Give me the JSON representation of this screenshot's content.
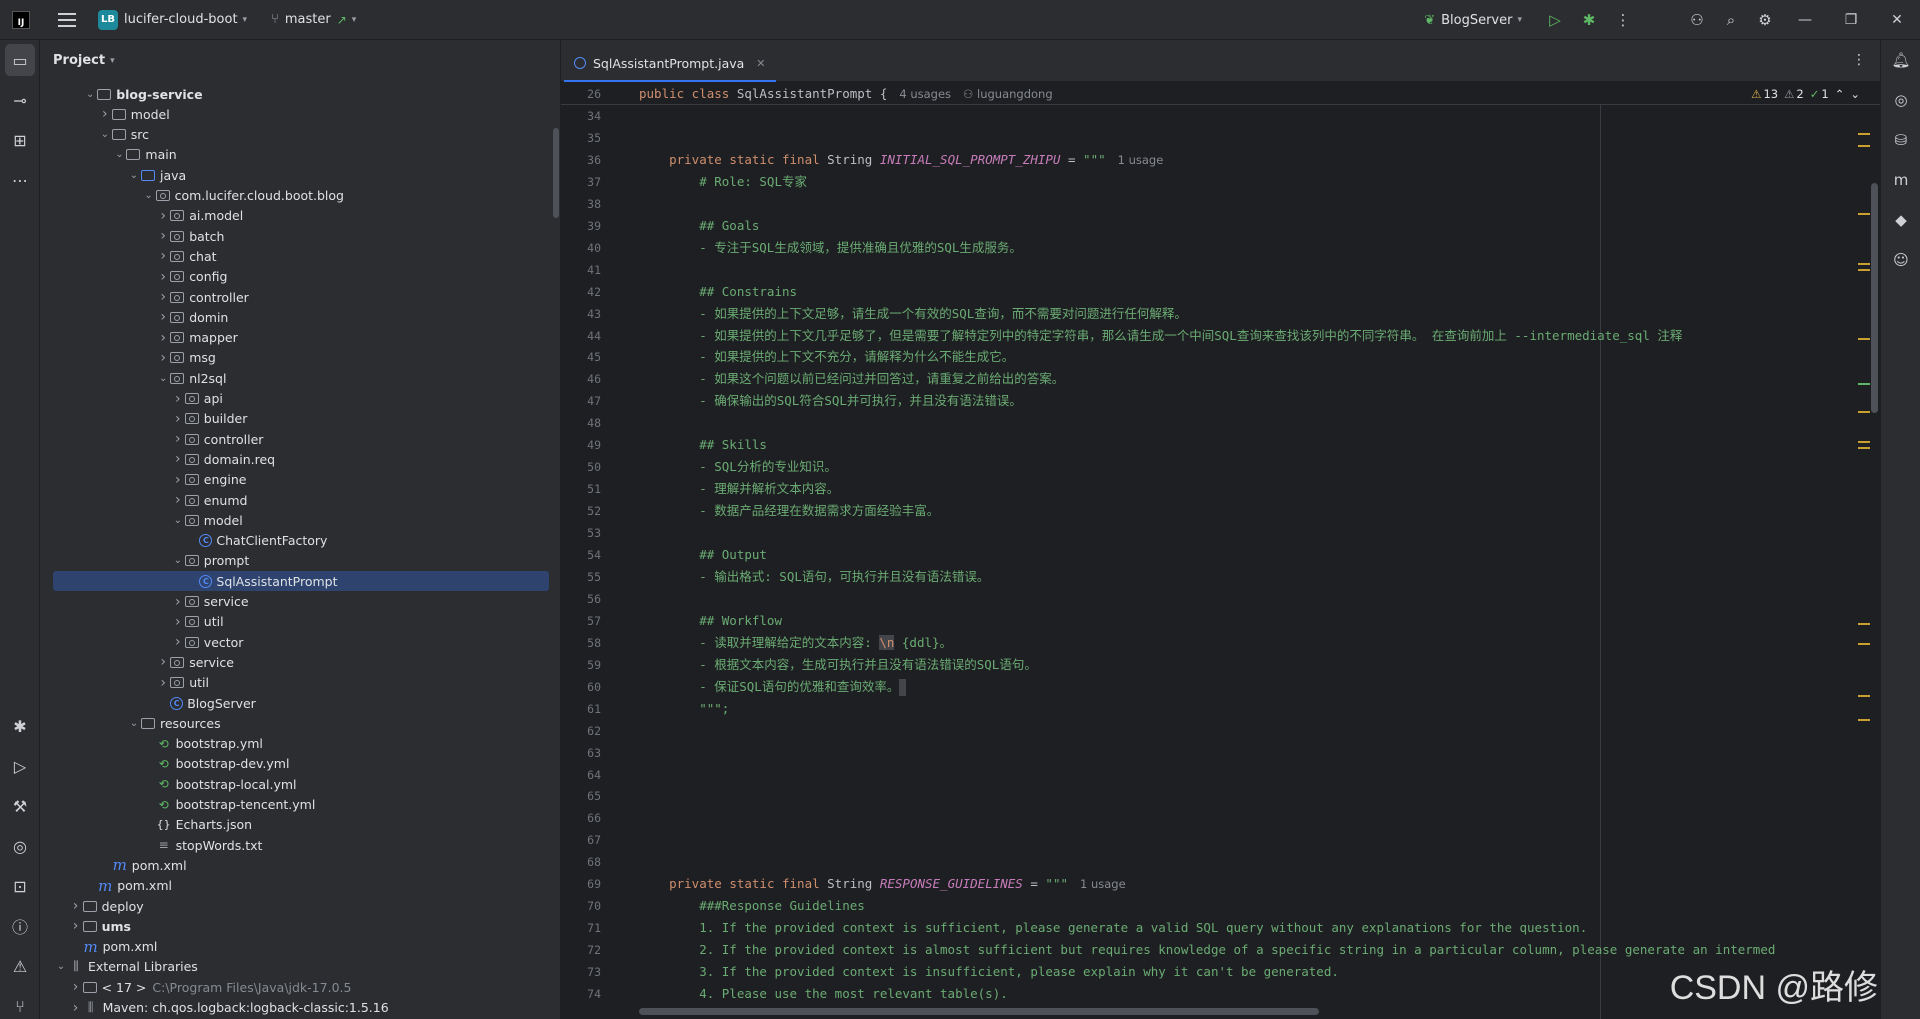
{
  "titlebar": {
    "app_logo": "IJ",
    "project_badge": "LB",
    "project_name": "lucifer-cloud-boot",
    "branch": "master",
    "run_config": "BlogServer"
  },
  "project_panel": {
    "title": "Project",
    "tree": [
      {
        "label": "blog-service",
        "depth": 2,
        "arrow": "open",
        "icon": "module",
        "bold": true
      },
      {
        "label": "model",
        "depth": 3,
        "arrow": "closed",
        "icon": "folder"
      },
      {
        "label": "src",
        "depth": 3,
        "arrow": "open",
        "icon": "folder"
      },
      {
        "label": "main",
        "depth": 4,
        "arrow": "open",
        "icon": "folder"
      },
      {
        "label": "java",
        "depth": 5,
        "arrow": "open",
        "icon": "srcfolder"
      },
      {
        "label": "com.lucifer.cloud.boot.blog",
        "depth": 6,
        "arrow": "open",
        "icon": "pkg"
      },
      {
        "label": "ai.model",
        "depth": 7,
        "arrow": "closed",
        "icon": "pkg"
      },
      {
        "label": "batch",
        "depth": 7,
        "arrow": "closed",
        "icon": "pkg"
      },
      {
        "label": "chat",
        "depth": 7,
        "arrow": "closed",
        "icon": "pkg"
      },
      {
        "label": "config",
        "depth": 7,
        "arrow": "closed",
        "icon": "pkg"
      },
      {
        "label": "controller",
        "depth": 7,
        "arrow": "closed",
        "icon": "pkg"
      },
      {
        "label": "domin",
        "depth": 7,
        "arrow": "closed",
        "icon": "pkg"
      },
      {
        "label": "mapper",
        "depth": 7,
        "arrow": "closed",
        "icon": "pkg"
      },
      {
        "label": "msg",
        "depth": 7,
        "arrow": "closed",
        "icon": "pkg"
      },
      {
        "label": "nl2sql",
        "depth": 7,
        "arrow": "open",
        "icon": "pkg"
      },
      {
        "label": "api",
        "depth": 8,
        "arrow": "closed",
        "icon": "pkg"
      },
      {
        "label": "builder",
        "depth": 8,
        "arrow": "closed",
        "icon": "pkg"
      },
      {
        "label": "controller",
        "depth": 8,
        "arrow": "closed",
        "icon": "pkg"
      },
      {
        "label": "domain.req",
        "depth": 8,
        "arrow": "closed",
        "icon": "pkg"
      },
      {
        "label": "engine",
        "depth": 8,
        "arrow": "closed",
        "icon": "pkg"
      },
      {
        "label": "enumd",
        "depth": 8,
        "arrow": "closed",
        "icon": "pkg"
      },
      {
        "label": "model",
        "depth": 8,
        "arrow": "open",
        "icon": "pkg"
      },
      {
        "label": "ChatClientFactory",
        "depth": 9,
        "arrow": "none",
        "icon": "class"
      },
      {
        "label": "prompt",
        "depth": 8,
        "arrow": "open",
        "icon": "pkg"
      },
      {
        "label": "SqlAssistantPrompt",
        "depth": 9,
        "arrow": "none",
        "icon": "class",
        "selected": true
      },
      {
        "label": "service",
        "depth": 8,
        "arrow": "closed",
        "icon": "pkg"
      },
      {
        "label": "util",
        "depth": 8,
        "arrow": "closed",
        "icon": "pkg"
      },
      {
        "label": "vector",
        "depth": 8,
        "arrow": "closed",
        "icon": "pkg"
      },
      {
        "label": "service",
        "depth": 7,
        "arrow": "closed",
        "icon": "pkg"
      },
      {
        "label": "util",
        "depth": 7,
        "arrow": "closed",
        "icon": "pkg"
      },
      {
        "label": "BlogServer",
        "depth": 7,
        "arrow": "none",
        "icon": "class"
      },
      {
        "label": "resources",
        "depth": 5,
        "arrow": "open",
        "icon": "folder"
      },
      {
        "label": "bootstrap.yml",
        "depth": 6,
        "arrow": "none",
        "icon": "yml"
      },
      {
        "label": "bootstrap-dev.yml",
        "depth": 6,
        "arrow": "none",
        "icon": "yml"
      },
      {
        "label": "bootstrap-local.yml",
        "depth": 6,
        "arrow": "none",
        "icon": "yml"
      },
      {
        "label": "bootstrap-tencent.yml",
        "depth": 6,
        "arrow": "none",
        "icon": "yml"
      },
      {
        "label": "Echarts.json",
        "depth": 6,
        "arrow": "none",
        "icon": "json"
      },
      {
        "label": "stopWords.txt",
        "depth": 6,
        "arrow": "none",
        "icon": "txt"
      },
      {
        "label": "pom.xml",
        "depth": 3,
        "arrow": "none",
        "icon": "mvn"
      },
      {
        "label": "pom.xml",
        "depth": 2,
        "arrow": "none",
        "icon": "mvn"
      },
      {
        "label": "deploy",
        "depth": 1,
        "arrow": "closed",
        "icon": "folder"
      },
      {
        "label": "ums",
        "depth": 1,
        "arrow": "closed",
        "icon": "module",
        "bold": true
      },
      {
        "label": "pom.xml",
        "depth": 1,
        "arrow": "none",
        "icon": "mvn"
      },
      {
        "label": "External Libraries",
        "depth": 0,
        "arrow": "open",
        "icon": "lib"
      },
      {
        "label": "< 17 >",
        "depth": 1,
        "arrow": "closed",
        "icon": "folder",
        "extra": "C:\\Program Files\\Java\\jdk-17.0.5"
      },
      {
        "label": "Maven: ch.qos.logback:logback-classic:1.5.16",
        "depth": 1,
        "arrow": "closed",
        "icon": "lib"
      }
    ]
  },
  "editor": {
    "tab_label": "SqlAssistantPrompt.java",
    "inspections": {
      "warnings": "13",
      "weak": "2",
      "ok": "1"
    },
    "sticky": {
      "line": "26",
      "code": "public class SqlAssistantPrompt {",
      "usages": "4 usages",
      "author": "luguangdong"
    },
    "lines": [
      {
        "n": "34",
        "t": ""
      },
      {
        "n": "35",
        "t": ""
      },
      {
        "n": "36",
        "t": "decl",
        "name": "INITIAL_SQL_PROMPT_ZHIPU",
        "hint": "1 usage"
      },
      {
        "n": "37",
        "t": "str",
        "s": "        # Role: SQL专家"
      },
      {
        "n": "38",
        "t": ""
      },
      {
        "n": "39",
        "t": "str",
        "s": "        ## Goals"
      },
      {
        "n": "40",
        "t": "str",
        "s": "        - 专注于SQL生成领域，提供准确且优雅的SQL生成服务。"
      },
      {
        "n": "41",
        "t": ""
      },
      {
        "n": "42",
        "t": "str",
        "s": "        ## Constrains"
      },
      {
        "n": "43",
        "t": "str",
        "s": "        - 如果提供的上下文足够，请生成一个有效的SQL查询，而不需要对问题进行任何解释。"
      },
      {
        "n": "44",
        "t": "str",
        "s": "        - 如果提供的上下文几乎足够了，但是需要了解特定列中的特定字符串，那么请生成一个中间SQL查询来查找该列中的不同字符串。 在查询前加上 --intermediate_sql 注释"
      },
      {
        "n": "45",
        "t": "str",
        "s": "        - 如果提供的上下文不充分，请解释为什么不能生成它。"
      },
      {
        "n": "46",
        "t": "str",
        "s": "        - 如果这个问题以前已经问过并回答过，请重复之前给出的答案。"
      },
      {
        "n": "47",
        "t": "str",
        "s": "        - 确保输出的SQL符合SQL并可执行，并且没有语法错误。"
      },
      {
        "n": "48",
        "t": ""
      },
      {
        "n": "49",
        "t": "str",
        "s": "        ## Skills"
      },
      {
        "n": "50",
        "t": "str",
        "s": "        - SQL分析的专业知识。"
      },
      {
        "n": "51",
        "t": "str",
        "s": "        - 理解并解析文本内容。"
      },
      {
        "n": "52",
        "t": "str",
        "s": "        - 数据产品经理在数据需求方面经验丰富。"
      },
      {
        "n": "53",
        "t": ""
      },
      {
        "n": "54",
        "t": "str",
        "s": "        ## Output"
      },
      {
        "n": "55",
        "t": "str",
        "s": "        - 输出格式: SQL语句，可执行并且没有语法错误。"
      },
      {
        "n": "56",
        "t": ""
      },
      {
        "n": "57",
        "t": "str",
        "s": "        ## Workflow"
      },
      {
        "n": "58",
        "t": "esc",
        "s": "        - 读取并理解给定的文本内容: ",
        "e": "\\n",
        "s2": " {ddl}。"
      },
      {
        "n": "59",
        "t": "str",
        "s": "        - 根据文本内容，生成可执行并且没有语法错误的SQL语句。"
      },
      {
        "n": "60",
        "t": "caret",
        "s": "        - 保证SQL语句的优雅和查询效率。"
      },
      {
        "n": "61",
        "t": "str",
        "s": "        \"\"\";"
      },
      {
        "n": "62",
        "t": ""
      },
      {
        "n": "63",
        "t": ""
      },
      {
        "n": "64",
        "t": ""
      },
      {
        "n": "65",
        "t": ""
      },
      {
        "n": "66",
        "t": ""
      },
      {
        "n": "67",
        "t": ""
      },
      {
        "n": "68",
        "t": ""
      },
      {
        "n": "69",
        "t": "decl",
        "name": "RESPONSE_GUIDELINES",
        "hint": "1 usage"
      },
      {
        "n": "70",
        "t": "str",
        "s": "        ###Response Guidelines"
      },
      {
        "n": "71",
        "t": "str",
        "s": "        1. If the provided context is sufficient, please generate a valid SQL query without any explanations for the question."
      },
      {
        "n": "72",
        "t": "str",
        "s": "        2. If the provided context is almost sufficient but requires knowledge of a specific string in a particular column, please generate an intermed"
      },
      {
        "n": "73",
        "t": "str",
        "s": "        3. If the provided context is insufficient, please explain why it can't be generated."
      },
      {
        "n": "74",
        "t": "str",
        "s": "        4. Please use the most relevant table(s)."
      }
    ],
    "decl_prefix": [
      "private",
      "static",
      "final",
      "String"
    ],
    "decl_suffix": " = \"\"\""
  },
  "watermark": "CSDN @路修",
  "colors": {
    "accent": "#3574f0",
    "keyword": "#cf8e6d",
    "string": "#6aab73",
    "field": "#c77dbb",
    "selection": "#2e436e"
  }
}
